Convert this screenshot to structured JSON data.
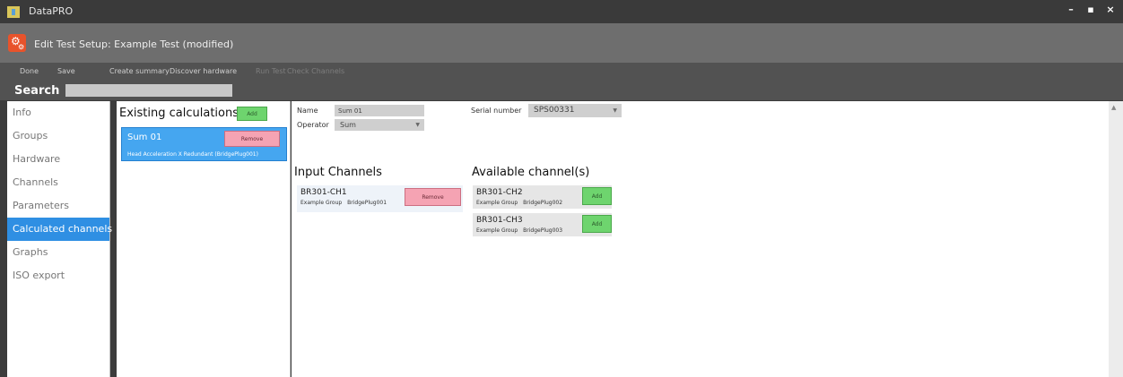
{
  "window": {
    "title": "DataPRO",
    "controls": [
      "–",
      "▪",
      "×"
    ]
  },
  "header": {
    "title": "Edit Test Setup: Example Test (modified)"
  },
  "toolbar": {
    "done": "Done",
    "save": "Save",
    "create_summary": "Create summary",
    "discover_hardware": "Discover hardware",
    "run_test": "Run Test",
    "check_channels": "Check Channels"
  },
  "search": {
    "label": "Search",
    "value": ""
  },
  "sidebar": {
    "items": [
      {
        "label": "Info",
        "active": false
      },
      {
        "label": "Groups",
        "active": false
      },
      {
        "label": "Hardware",
        "active": false
      },
      {
        "label": "Channels",
        "active": false
      },
      {
        "label": "Parameters",
        "active": false
      },
      {
        "label": "Calculated channels",
        "active": true
      },
      {
        "label": "Graphs",
        "active": false
      },
      {
        "label": "ISO export",
        "active": false
      }
    ]
  },
  "calculations": {
    "heading": "Existing calculations",
    "add_label": "Add",
    "items": [
      {
        "name": "Sum 01",
        "description": "Head Acceleration X Redundant (BridgePlug001)",
        "remove_label": "Remove"
      }
    ]
  },
  "form": {
    "name_label": "Name",
    "name_value": "Sum 01",
    "operator_label": "Operator",
    "operator_value": "Sum",
    "serial_label": "Serial number",
    "serial_value": "SPS00331"
  },
  "input_channels": {
    "heading": "Input Channels",
    "items": [
      {
        "name": "BR301-CH1",
        "group": "Example Group",
        "device": "BridgePlug001",
        "button": "Remove"
      }
    ]
  },
  "available_channels": {
    "heading": "Available channel(s)",
    "items": [
      {
        "name": "BR301-CH2",
        "group": "Example Group",
        "device": "BridgePlug002",
        "button": "Add"
      },
      {
        "name": "BR301-CH3",
        "group": "Example Group",
        "device": "BridgePlug003",
        "button": "Add"
      }
    ]
  },
  "colors": {
    "accent": "#2f8fe3",
    "add_button": "#6ed46e",
    "remove_button": "#f5a3b3",
    "header_icon": "#e8532b"
  }
}
